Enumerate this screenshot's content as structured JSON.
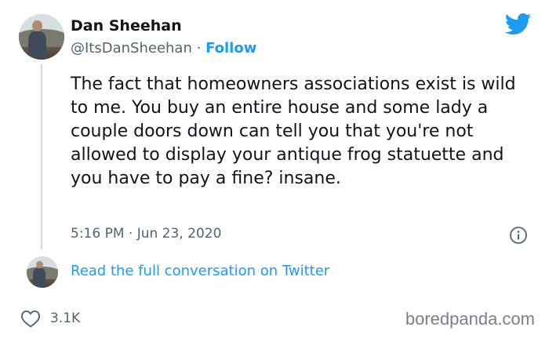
{
  "author": {
    "display_name": "Dan Sheehan",
    "handle": "@ItsDanSheehan",
    "separator": "·",
    "follow_label": "Follow"
  },
  "tweet": {
    "text": "The fact that homeowners associations exist is wild to me. You buy an entire house and some lady a couple doors down can tell you that you're not allowed to display your antique frog statuette and you have to pay a fine? insane.",
    "time": "5:16 PM",
    "date": "Jun 23, 2020",
    "timestamp_separator": "·"
  },
  "conversation": {
    "link_label": "Read the full conversation on Twitter"
  },
  "engagement": {
    "likes": "3.1K"
  },
  "watermark": "boredpanda.com",
  "icons": {
    "brand": "twitter-bird-icon",
    "info": "info-icon",
    "like": "heart-icon"
  },
  "colors": {
    "link": "#1d9bf0",
    "text": "#0f1419",
    "muted": "#536471",
    "thread_line": "#cfd9de"
  }
}
